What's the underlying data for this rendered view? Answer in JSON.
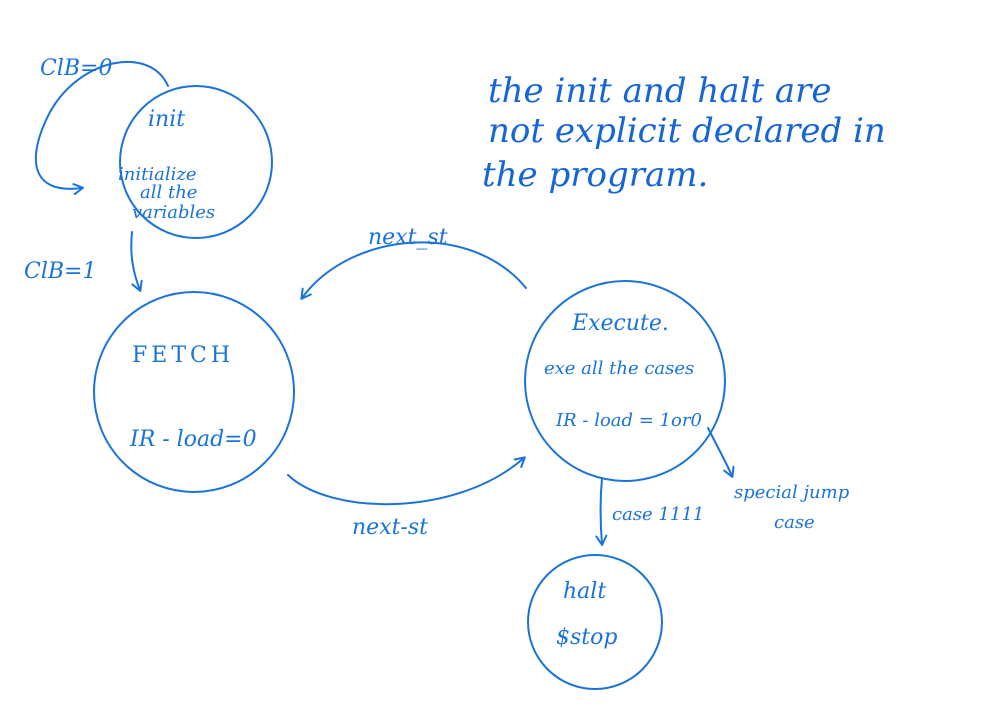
{
  "states": {
    "init": {
      "name": "init",
      "line1": "initialize",
      "line2": "all the",
      "line3": "variables"
    },
    "fetch": {
      "name": "FETCH",
      "detail": "IR - load=0"
    },
    "execute": {
      "name": "Execute.",
      "detail": "exe all the cases",
      "load": "IR - load = 1or0"
    },
    "halt": {
      "name": "halt",
      "detail": "$stop"
    }
  },
  "transitions": {
    "clb0": "ClB=0",
    "clb1": "ClB=1",
    "fetch_to_execute": "next-st",
    "execute_to_fetch": "next_st",
    "case_halt": "case 1111",
    "special_line1": "special jump",
    "special_line2": "case"
  },
  "note": {
    "line1": "the init and halt are",
    "line2": "not explicit declared in",
    "line3": "the program."
  },
  "colors": {
    "ink": "#1a73d9"
  }
}
